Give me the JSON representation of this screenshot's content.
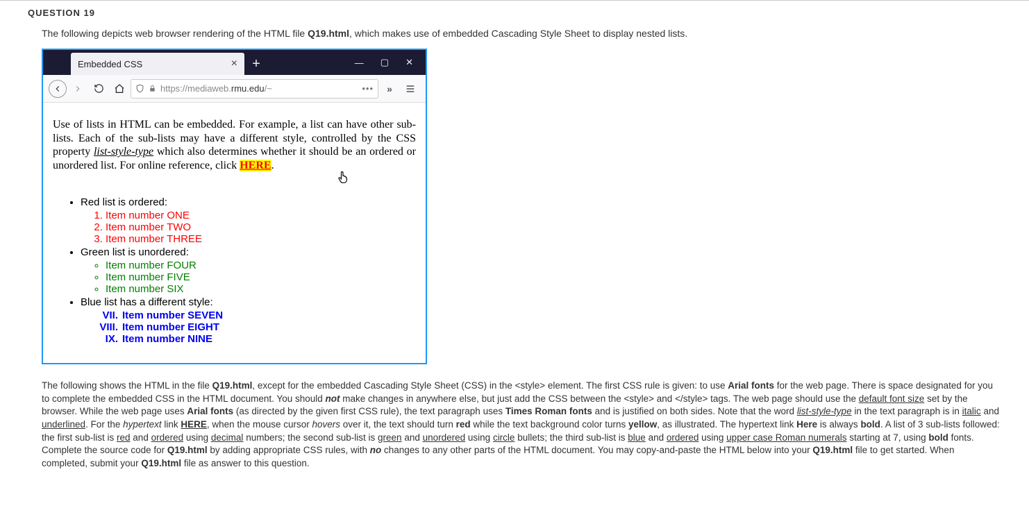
{
  "header": "QUESTION 19",
  "intro": {
    "pre": "The following depicts web browser rendering of the HTML file ",
    "file": "Q19.html",
    "post": ", which makes use of embedded Cascading Style Sheet to display nested lists."
  },
  "browser": {
    "tab_title": "Embedded CSS",
    "url_prefix": "https://mediaweb.",
    "url_dark": "rmu.edu",
    "url_suffix": "/~",
    "paragraph": {
      "t1": "Use of lists in HTML can be embedded. For example, a list can have other sub-lists. Each of the sub-lists may have a different style, controlled by the CSS property ",
      "prop": "list-style-type",
      "t2": " which also determines whether it should be an ordered or unordered list. For online reference, click ",
      "here": "HERE",
      "t3": "."
    },
    "lists": {
      "red_label": "Red list is ordered:",
      "red_items": [
        "Item number ONE",
        "Item number TWO",
        "Item number THREE"
      ],
      "green_label": "Green list is unordered:",
      "green_items": [
        "Item number FOUR",
        "Item number FIVE",
        "Item number SIX"
      ],
      "blue_label": "Blue list has a different style:",
      "blue_items": [
        {
          "rn": "VII.",
          "txt": "Item number SEVEN"
        },
        {
          "rn": "VIII.",
          "txt": "Item number EIGHT"
        },
        {
          "rn": "IX.",
          "txt": "Item number NINE"
        }
      ]
    }
  },
  "instr": {
    "s1a": "The following shows the HTML in the file ",
    "s1b": "Q19.html",
    "s1c": ", except for the embedded Cascading Style Sheet (CSS) in the <style> element.  The first CSS rule is given: to use ",
    "s1d": "Arial fonts",
    "s1e": " for the web page.   There is space designated for you to complete the embedded CSS in the HTML document. You should ",
    "s1f": "not",
    "s1g": " make changes in anywhere else, but just add the CSS between the <style> and </style> tags.  The web page should use the ",
    "s1h": "default font size",
    "s1i": " set by the browser.  While the web page uses ",
    "s1j": "Arial fonts",
    "s1k": " (as directed by the given first CSS rule), the text paragraph uses ",
    "s1l": "Times Roman fonts",
    "s1m": " and is justified on both sides.  Note that the word ",
    "s1n": "list-style-type",
    "s1o": " in the text paragraph is in ",
    "s1p": "italic",
    "s1q": " and ",
    "s1r": "underlined",
    "s1s": ".  For the ",
    "s1t": "hypertext",
    "s1u": " link ",
    "s1v": "HERE",
    "s1w": ", when the mouse cursor ",
    "s1x": "hovers",
    "s1y": " over it, the text should turn ",
    "s1z": "red",
    "s2a": " while the text background color turns ",
    "s2b": "yellow",
    "s2c": ", as illustrated.  The hypertext link ",
    "s2d": "Here",
    "s2e": " is always ",
    "s2f": "bold",
    "s2g": ".  A list of 3 sub-lists followed: the first sub-list is ",
    "s2h": "red",
    "s2i": " and ",
    "s2j": "ordered",
    "s2k": " using ",
    "s2l": "decimal",
    "s2m": " numbers; the second sub-list is ",
    "s2n": "green",
    "s2o": " and ",
    "s2p": "unordered",
    "s2q": " using ",
    "s2r": "circle",
    "s2s": " bullets; the third sub-list is ",
    "s2t": "blue",
    "s2u": " and ",
    "s2v": "ordered",
    "s2w": " using ",
    "s2x": "upper case Roman numerals",
    "s2y": " starting at 7, using ",
    "s2z": "bold",
    "s3a": " fonts.  Complete the source code for ",
    "s3b": "Q19.html",
    "s3c": " by adding appropriate CSS rules, with ",
    "s3d": "no",
    "s3e": " changes to any other parts of the HTML document.  You may copy-and-paste the HTML below into your ",
    "s3f": "Q19.html",
    "s3g": " file to get started.  When completed, submit your ",
    "s3h": "Q19.html",
    "s3i": " file as answer to this question."
  }
}
